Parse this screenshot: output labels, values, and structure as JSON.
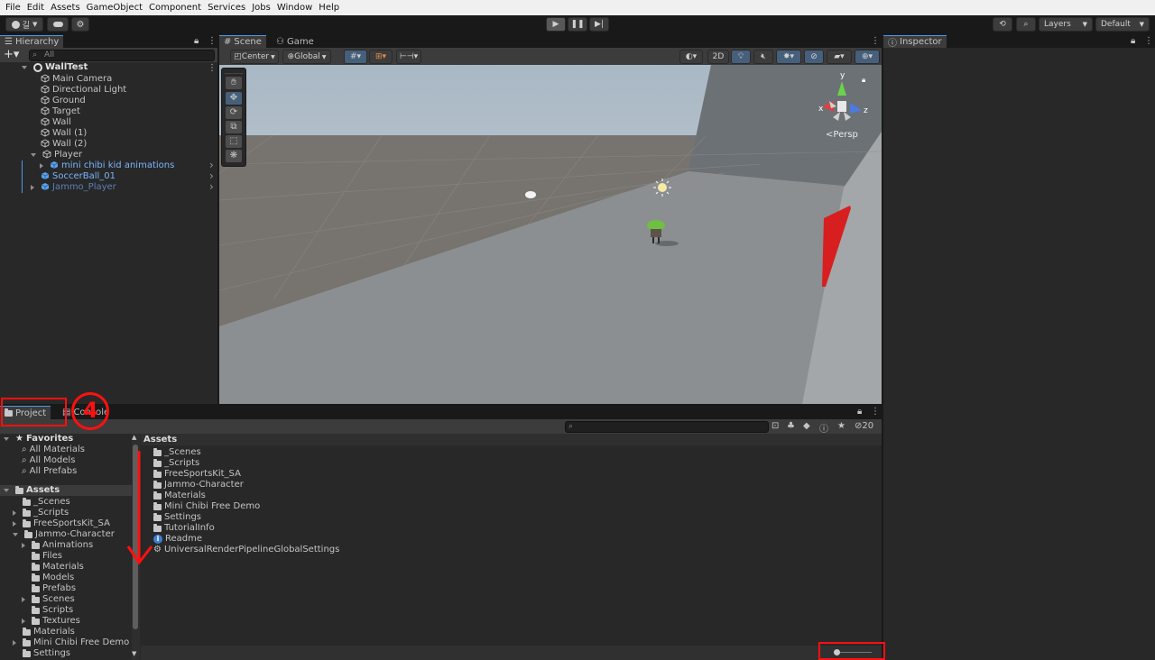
{
  "menu": [
    "File",
    "Edit",
    "Assets",
    "GameObject",
    "Component",
    "Services",
    "Jobs",
    "Window",
    "Help"
  ],
  "toolbar": {
    "account_label": "길",
    "layers_label": "Layers",
    "layout_label": "Default"
  },
  "hierarchy": {
    "tab_label": "Hierarchy",
    "search_placeholder": "All",
    "scene_name": "WallTest",
    "items": [
      {
        "label": "Main Camera",
        "indent": 1,
        "style": "normal"
      },
      {
        "label": "Directional Light",
        "indent": 1,
        "style": "normal"
      },
      {
        "label": "Ground",
        "indent": 1,
        "style": "normal"
      },
      {
        "label": "Target",
        "indent": 1,
        "style": "normal"
      },
      {
        "label": "Wall",
        "indent": 1,
        "style": "normal"
      },
      {
        "label": "Wall (1)",
        "indent": 1,
        "style": "normal"
      },
      {
        "label": "Wall (2)",
        "indent": 1,
        "style": "normal"
      },
      {
        "label": "Player",
        "indent": 1,
        "style": "normal"
      },
      {
        "label": "mini chibi kid animations",
        "indent": 2,
        "style": "blue"
      },
      {
        "label": "SoccerBall_01",
        "indent": 1,
        "style": "blue"
      },
      {
        "label": "Jammo_Player",
        "indent": 1,
        "style": "dim"
      }
    ]
  },
  "scene": {
    "tab_scene": "Scene",
    "tab_game": "Game",
    "pivot_label": "Center",
    "space_label": "Global",
    "mode_2d": "2D",
    "persp_label": "Persp",
    "gizmo_x": "x",
    "gizmo_y": "y",
    "gizmo_z": "z"
  },
  "inspector": {
    "tab_label": "Inspector"
  },
  "project": {
    "tab_project": "Project",
    "tab_console": "Console",
    "hidden_count": "20",
    "favorites_label": "Favorites",
    "favorites": [
      "All Materials",
      "All Models",
      "All Prefabs"
    ],
    "assets_label": "Assets",
    "tree": [
      {
        "label": "_Scenes",
        "indent": 1,
        "expand": "none"
      },
      {
        "label": "_Scripts",
        "indent": 1,
        "expand": "right"
      },
      {
        "label": "FreeSportsKit_SA",
        "indent": 1,
        "expand": "right"
      },
      {
        "label": "Jammo-Character",
        "indent": 1,
        "expand": "down"
      },
      {
        "label": "Animations",
        "indent": 2,
        "expand": "right"
      },
      {
        "label": "Files",
        "indent": 2,
        "expand": "none"
      },
      {
        "label": "Materials",
        "indent": 2,
        "expand": "none"
      },
      {
        "label": "Models",
        "indent": 2,
        "expand": "none"
      },
      {
        "label": "Prefabs",
        "indent": 2,
        "expand": "none"
      },
      {
        "label": "Scenes",
        "indent": 2,
        "expand": "right"
      },
      {
        "label": "Scripts",
        "indent": 2,
        "expand": "none"
      },
      {
        "label": "Textures",
        "indent": 2,
        "expand": "right"
      },
      {
        "label": "Materials",
        "indent": 1,
        "expand": "none"
      },
      {
        "label": "Mini Chibi Free Demo",
        "indent": 1,
        "expand": "right"
      },
      {
        "label": "Settings",
        "indent": 1,
        "expand": "none"
      }
    ],
    "breadcrumb": "Assets",
    "contents": [
      {
        "label": "_Scenes",
        "icon": "folder"
      },
      {
        "label": "_Scripts",
        "icon": "folder"
      },
      {
        "label": "FreeSportsKit_SA",
        "icon": "folder"
      },
      {
        "label": "Jammo-Character",
        "icon": "folder"
      },
      {
        "label": "Materials",
        "icon": "folder"
      },
      {
        "label": "Mini Chibi Free Demo",
        "icon": "folder"
      },
      {
        "label": "Settings",
        "icon": "folder"
      },
      {
        "label": "TutorialInfo",
        "icon": "folder"
      },
      {
        "label": "Readme",
        "icon": "info"
      },
      {
        "label": "UniversalRenderPipelineGlobalSettings",
        "icon": "settings"
      }
    ]
  },
  "annotation": {
    "step_number": "4"
  }
}
